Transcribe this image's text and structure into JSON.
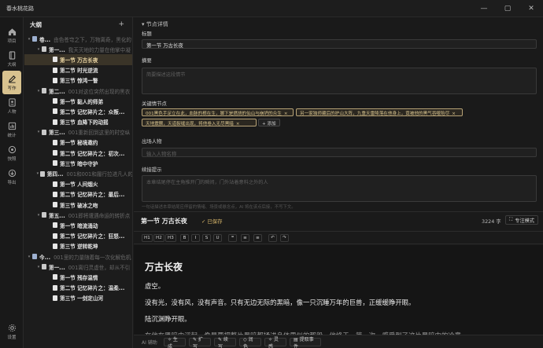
{
  "app": {
    "title": "春水桃花路"
  },
  "window": {
    "min": "—",
    "max": "▢",
    "close": "✕"
  },
  "rail": {
    "items": [
      {
        "label": "项目",
        "icon": "home-icon"
      },
      {
        "label": "大纲",
        "icon": "book-icon"
      },
      {
        "label": "写作",
        "icon": "pen-icon"
      },
      {
        "label": "人物",
        "icon": "person-card-icon"
      },
      {
        "label": "统计",
        "icon": "chart-icon"
      },
      {
        "label": "快照",
        "icon": "camera-icon"
      },
      {
        "label": "导出",
        "icon": "export-icon"
      }
    ],
    "settings": "设置"
  },
  "outline": {
    "title": "大纲",
    "add": "+",
    "nodes": [
      {
        "type": "vol",
        "title": "卷...",
        "sub": "由色苍穹之下，万物离奇，黑化的",
        "arrow": "▾"
      },
      {
        "type": "chap",
        "title": "第一...",
        "sub": "我天灭地的力量在他掌中凝",
        "arrow": "▾"
      },
      {
        "type": "sec",
        "title": "第一节 万古长夜",
        "sub": "",
        "arrow": "",
        "selected": true
      },
      {
        "type": "sec",
        "title": "第二节 时光逆流",
        "sub": "",
        "arrow": ""
      },
      {
        "type": "sec",
        "title": "第三节 惊鸿一瞥",
        "sub": "",
        "arrow": ""
      },
      {
        "type": "chap",
        "title": "第二...",
        "sub": "001对这位突然出现的黑衣",
        "arrow": "▾"
      },
      {
        "type": "sec",
        "title": "第一节 黏人的师弟",
        "sub": "",
        "arrow": ""
      },
      {
        "type": "sec",
        "title": "第二节 记忆碎片之：众叛...",
        "sub": "",
        "arrow": ""
      },
      {
        "type": "sec",
        "title": "第三节 血降下的动摇",
        "sub": "",
        "arrow": ""
      },
      {
        "type": "chap",
        "title": "第三...",
        "sub": "001重新回到这里的时空纵",
        "arrow": "▾"
      },
      {
        "type": "sec",
        "title": "第一节 秘境邀约",
        "sub": "",
        "arrow": ""
      },
      {
        "type": "sec",
        "title": "第二节 记忆碎片之：初次...",
        "sub": "",
        "arrow": ""
      },
      {
        "type": "sec",
        "title": "第三节 暗中守护",
        "sub": "",
        "arrow": ""
      },
      {
        "type": "chap",
        "title": "第四...",
        "sub": "001和001和履行拉进凡人的",
        "arrow": "▾"
      },
      {
        "type": "sec",
        "title": "第一节 人间烟火",
        "sub": "",
        "arrow": ""
      },
      {
        "type": "sec",
        "title": "第二节 记忆碎片之：最后...",
        "sub": "",
        "arrow": ""
      },
      {
        "type": "sec",
        "title": "第三节 破冰之吻",
        "sub": "",
        "arrow": ""
      },
      {
        "type": "chap",
        "title": "第五...",
        "sub": "001即将遭遇命运的转折点",
        "arrow": "▾"
      },
      {
        "type": "sec",
        "title": "第一节 暗流涌动",
        "sub": "",
        "arrow": ""
      },
      {
        "type": "sec",
        "title": "第二节 记忆碎片之：狂怒...",
        "sub": "",
        "arrow": ""
      },
      {
        "type": "sec",
        "title": "第三节 逆转乾坤",
        "sub": "",
        "arrow": ""
      },
      {
        "type": "vol",
        "title": "今...",
        "sub": "001里的力量随着每一次化解危机",
        "arrow": "▾"
      },
      {
        "type": "chap",
        "title": "第一...",
        "sub": "001离归灵虚世，却从不引",
        "arrow": "▾"
      },
      {
        "type": "sec",
        "title": "第一节 残存温情",
        "sub": "",
        "arrow": ""
      },
      {
        "type": "sec",
        "title": "第二节 记忆碎片之：温柔...",
        "sub": "",
        "arrow": ""
      },
      {
        "type": "sec",
        "title": "第三节 一剑定山河",
        "sub": "",
        "arrow": ""
      }
    ]
  },
  "detail": {
    "section_title": "节点详情",
    "collapse_arrow": "▾",
    "title_label": "标题",
    "title_value": "第一节 万古长夜",
    "summary_label": "摘要",
    "summary_placeholder": "简要描述这段情节",
    "keynodes_label": "关键情节点",
    "tags": [
      "001黑色手足立在此，血脉的根在生，脚下是燃烧的仙山与崩坍的众生",
      "另一家独师藏后的护山大阵，九重天雷降落在他身上，竟被他的黑气吞噬殆尽",
      "天地震颤，天道裂缝出现，将他卷入无尽黑暗",
      "+ 添加"
    ],
    "tag_close": "×",
    "characters_label": "出场人物",
    "characters_placeholder": "输入人物名称",
    "prompt_label": "续接提示",
    "prompt_placeholder": "本章结尾停在主角推开门的瞬间，门外站着意料之外的人",
    "hint": "一句话描述本章结尾应停留的情绪、场景或悬念点，AI 将在该点后接，不写下文。"
  },
  "doc": {
    "title": "第一节 万古长夜",
    "saved": "✓ 已保存",
    "word_count": "3224 字",
    "focus_mode": "专注模式",
    "format_buttons": [
      "H1",
      "H2",
      "H3",
      "B",
      "I",
      "S",
      "U",
      "❝",
      "≡",
      "≡",
      "↶",
      "↷"
    ],
    "heading": "万古长夜",
    "paragraphs": [
      "虚空。",
      "没有光，没有风，没有声音。只有无边无际的黑暗，像一只沉睡万年的巨兽，正缓缓睁开眼。",
      "陆沉渊睁开眼。",
      "在他在黑暗中浮起，像是要把整片黑暗都揉进身体里似的那般，他终于，第一次，感受到了这片黑暗中的冷意。"
    ]
  },
  "ai": {
    "label": "AI 辅助",
    "buttons": [
      "✧ 生成",
      "✎ 扩写",
      "✎ 续写",
      "◇ 润色",
      "✧ 灵感",
      "▤ 提取事件"
    ]
  }
}
